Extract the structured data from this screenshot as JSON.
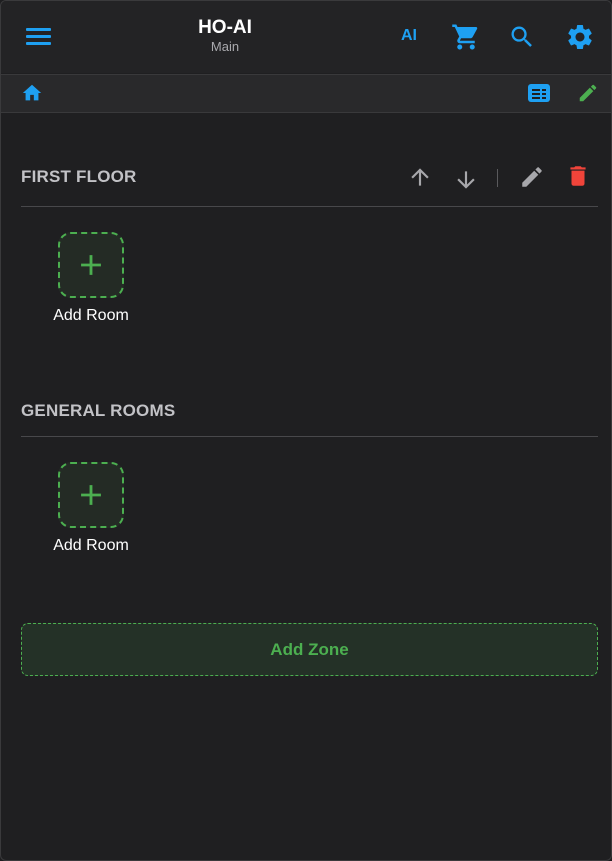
{
  "header": {
    "title": "HO-AI",
    "subtitle": "Main",
    "ai_label": "AI"
  },
  "zones": [
    {
      "name": "FIRST FLOOR",
      "add_room_label": "Add Room"
    },
    {
      "name": "GENERAL ROOMS",
      "add_room_label": "Add Room"
    }
  ],
  "add_zone_label": "Add Zone",
  "colors": {
    "accent_blue": "#1ea0f2",
    "accent_green": "#4caf50",
    "delete_red": "#f0443a",
    "muted_icon": "#a7a7ab"
  },
  "icons": {
    "menu": "menu-icon",
    "cart": "cart-icon",
    "search": "search-icon",
    "settings": "gear-icon",
    "home": "home-icon",
    "list": "list-view-icon",
    "edit": "pencil-icon",
    "up": "arrow-up-icon",
    "down": "arrow-down-icon",
    "delete": "trash-icon",
    "add": "plus-icon"
  }
}
